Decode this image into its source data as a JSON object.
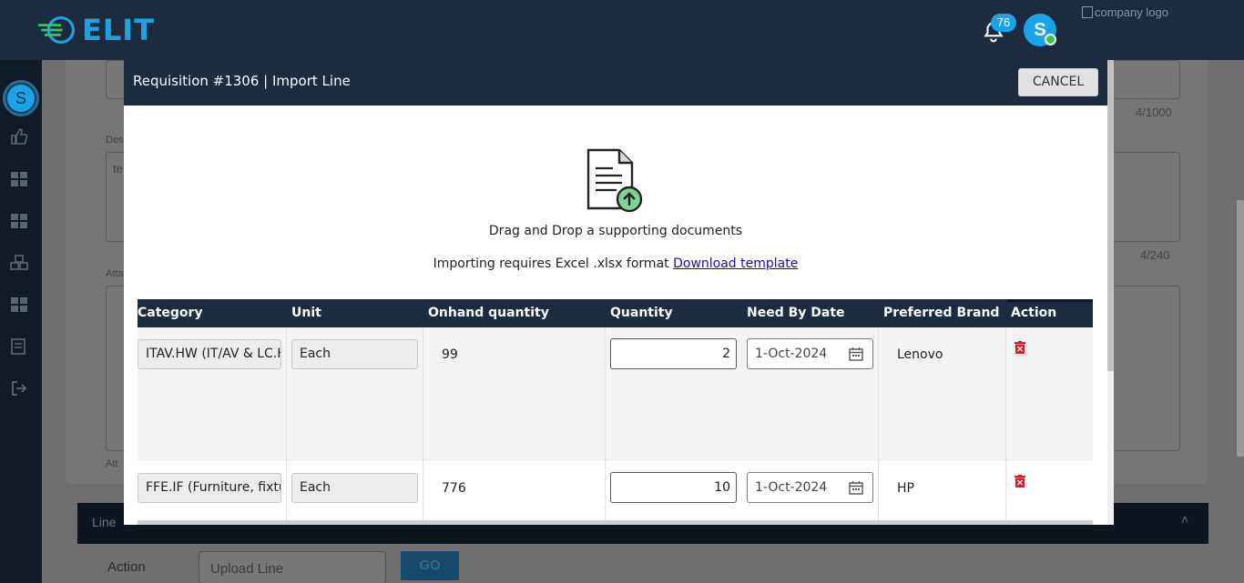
{
  "app": {
    "brand": "ELIT",
    "notifications_count": "76",
    "user_initial": "S",
    "company_logo_alt": "company logo"
  },
  "background": {
    "counter_1": "4/1000",
    "field_label_desc": "Des",
    "desc_value": "te",
    "counter_2": "4/240",
    "attach_label": "Atta",
    "attach_label_2": "Att",
    "line_section_title": "Line",
    "action_label": "Action",
    "action_select_value": "Upload Line",
    "go_button": "GO"
  },
  "modal": {
    "title": "Requisition #1306 | Import Line",
    "cancel_label": "CANCEL",
    "drop_text": "Drag and Drop a supporting documents",
    "import_text": "Importing requires Excel .xlsx format",
    "download_link": "Download template"
  },
  "table": {
    "headers": [
      "Category",
      "Unit",
      "Onhand quantity",
      "Quantity",
      "Need By Date",
      "Preferred Brand",
      "Action"
    ],
    "rows": [
      {
        "category": "ITAV.HW (IT/AV & LC.H",
        "unit": "Each",
        "onhand": "99",
        "quantity": "2",
        "need_by": "1-Oct-2024",
        "brand": "Lenovo"
      },
      {
        "category": "FFE.IF (Furniture, fixtur",
        "unit": "Each",
        "onhand": "776",
        "quantity": "10",
        "need_by": "1-Oct-2024",
        "brand": "HP"
      }
    ]
  },
  "colors": {
    "header_bg": "#1c2b3d",
    "accent_blue": "#1aa3e8",
    "delete_red": "#e0192b",
    "link_blue": "#1a0dab",
    "online_green": "#39c24a"
  },
  "icons": {
    "bell": "bell-icon",
    "upload": "document-upload-icon",
    "calendar": "calendar-icon",
    "delete": "trash-icon"
  }
}
